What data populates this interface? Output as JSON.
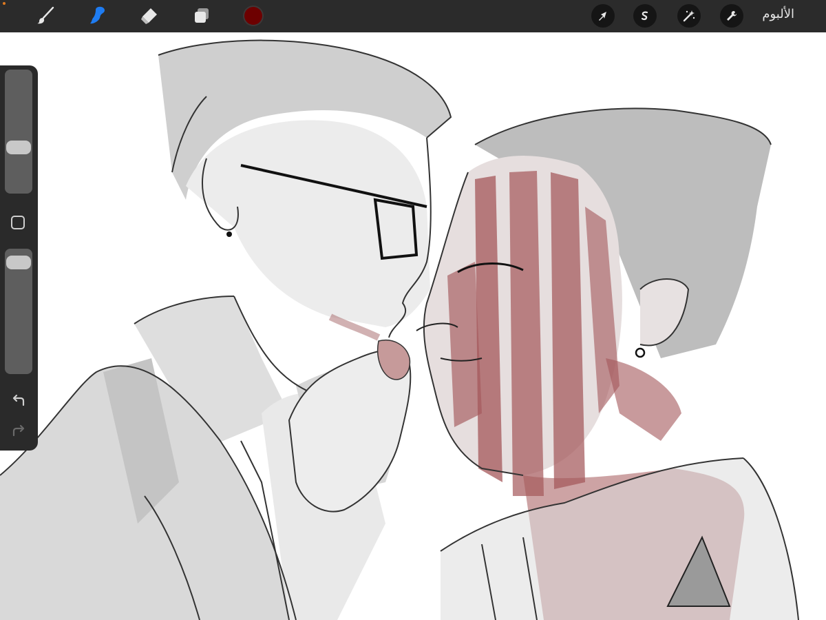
{
  "toolbar": {
    "tools": [
      {
        "name": "brush",
        "icon": "brush-icon",
        "active": false
      },
      {
        "name": "smudge",
        "icon": "smudge-icon",
        "active": true
      },
      {
        "name": "eraser",
        "icon": "eraser-icon",
        "active": false
      },
      {
        "name": "layers",
        "icon": "layers-icon",
        "active": false
      }
    ],
    "current_color": "#6d0000",
    "active_tool_color": "#1e7cf2",
    "actions": [
      {
        "name": "transform",
        "icon": "cursor-arrow-icon"
      },
      {
        "name": "selection",
        "icon": "selection-s-icon"
      },
      {
        "name": "adjustments",
        "icon": "magic-wand-icon"
      },
      {
        "name": "actions",
        "icon": "wrench-icon"
      }
    ],
    "gallery_label": "الألبوم"
  },
  "sidebar": {
    "brush_size_level": 0.35,
    "opacity_level": 0.95,
    "undo_icon": "undo-icon",
    "redo_icon": "redo-icon",
    "modify_icon": "square-icon"
  },
  "colors": {
    "toolbar_bg": "#2b2b2b",
    "sidebar_bg": "#2a2a2a",
    "accent_orange": "#e07a1f",
    "blood": "#a4575a"
  }
}
